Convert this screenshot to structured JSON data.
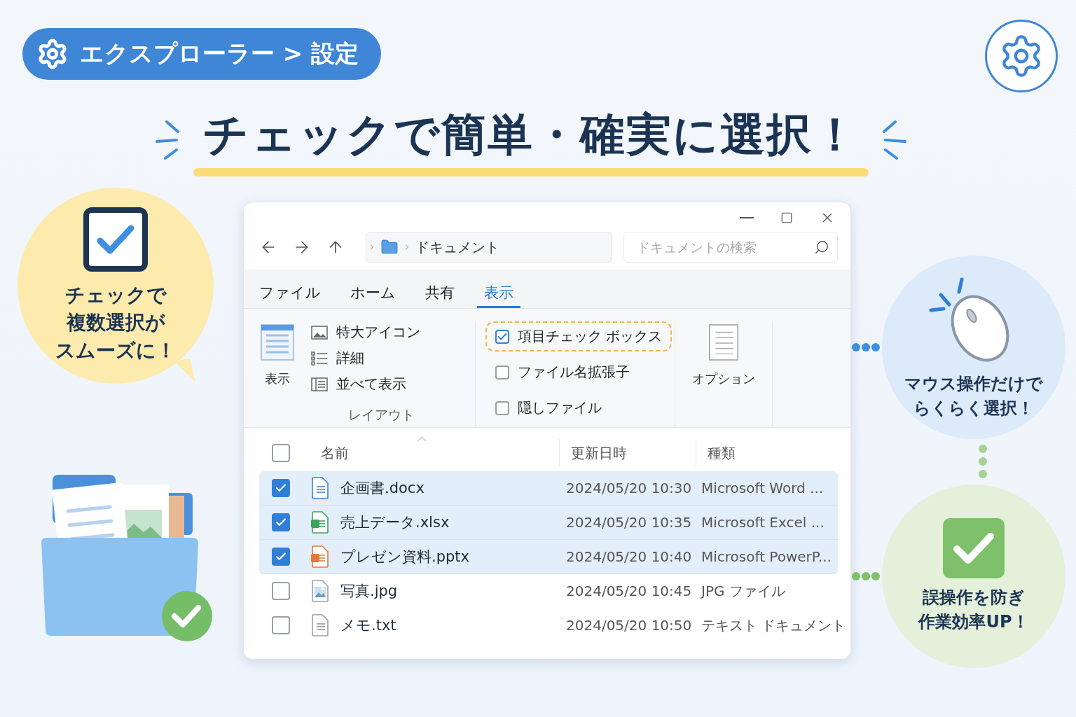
{
  "badge": {
    "text": "エクスプローラー > 設定"
  },
  "headline": "チェックで簡単・確実に選択！",
  "left_bubble": {
    "lines": [
      "チェックで",
      "複数選択が",
      "スムーズに！"
    ]
  },
  "window": {
    "address": "ドキュメント",
    "search": {
      "placeholder": "ドキュメントの検索"
    },
    "tabs": [
      {
        "label": "ファイル",
        "selected": false
      },
      {
        "label": "ホーム",
        "selected": false
      },
      {
        "label": "共有",
        "selected": false
      },
      {
        "label": "表示",
        "selected": true
      }
    ],
    "ribbon": {
      "view_button": "表示",
      "layouts": [
        {
          "kind": "large",
          "label": "特大アイコン"
        },
        {
          "kind": "details",
          "label": "詳細"
        },
        {
          "kind": "tiles",
          "label": "並べて表示"
        }
      ],
      "layout_group": "レイアウト",
      "toggles": [
        {
          "label": "項目チェック ボックス",
          "checked": true,
          "highlighted": true
        },
        {
          "label": "ファイル名拡張子",
          "checked": false,
          "highlighted": false
        },
        {
          "label": "隠しファイル",
          "checked": false,
          "highlighted": false
        }
      ],
      "options_button": "オプション"
    },
    "header_checkbox": {
      "checked": false
    },
    "columns": [
      "名前",
      "更新日時",
      "種類"
    ],
    "rows": [
      {
        "kind": "word",
        "name": "企画書.docx",
        "date": "2024/05/20 10:30",
        "type": "Microsoft Word ...",
        "selected": true
      },
      {
        "kind": "excel",
        "name": "売上データ.xlsx",
        "date": "2024/05/20 10:35",
        "type": "Microsoft Excel ...",
        "selected": true
      },
      {
        "kind": "powerpoint",
        "name": "プレゼン資料.pptx",
        "date": "2024/05/20 10:40",
        "type": "Microsoft PowerP...",
        "selected": true
      },
      {
        "kind": "image",
        "name": "写真.jpg",
        "date": "2024/05/20 10:45",
        "type": "JPG ファイル",
        "selected": false
      },
      {
        "kind": "text",
        "name": "メモ.txt",
        "date": "2024/05/20 10:50",
        "type": "テキスト ドキュメント",
        "selected": false
      }
    ]
  },
  "callouts": [
    {
      "kind": "mouse",
      "lines": [
        "マウス操作だけで",
        "らくらく選択！"
      ]
    },
    {
      "kind": "check",
      "lines": [
        "誤操作を防ぎ",
        "作業効率UP！"
      ]
    }
  ]
}
